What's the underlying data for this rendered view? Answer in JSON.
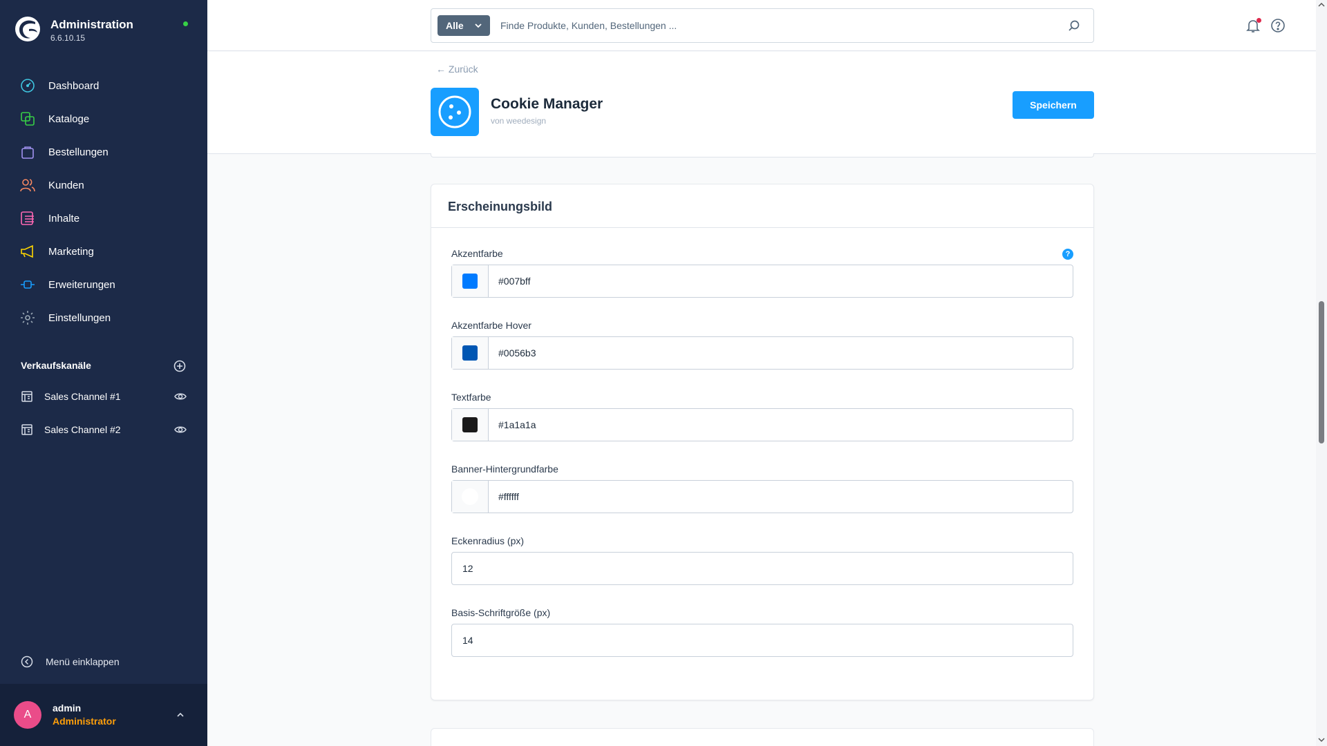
{
  "brand": {
    "title": "Administration",
    "version": "6.6.10.15",
    "status_color": "#37d046"
  },
  "nav": [
    {
      "label": "Dashboard",
      "icon": "dashboard-icon",
      "color": "#3fc6e0"
    },
    {
      "label": "Kataloge",
      "icon": "catalog-icon",
      "color": "#37d046"
    },
    {
      "label": "Bestellungen",
      "icon": "bag-icon",
      "color": "#a092f0"
    },
    {
      "label": "Kunden",
      "icon": "users-icon",
      "color": "#f88962"
    },
    {
      "label": "Inhalte",
      "icon": "content-icon",
      "color": "#ff68b4"
    },
    {
      "label": "Marketing",
      "icon": "megaphone-icon",
      "color": "#ffd700"
    },
    {
      "label": "Erweiterungen",
      "icon": "plugin-icon",
      "color": "#189eff"
    },
    {
      "label": "Einstellungen",
      "icon": "gear-icon",
      "color": "#9aa8b5"
    }
  ],
  "sales_channels": {
    "title": "Verkaufskanäle",
    "items": [
      {
        "label": "Sales Channel #1"
      },
      {
        "label": "Sales Channel #2"
      }
    ]
  },
  "collapse_label": "Menü einklappen",
  "user": {
    "initial": "A",
    "name": "admin",
    "role": "Administrator"
  },
  "search": {
    "type_label": "Alle",
    "placeholder": "Finde Produkte, Kunden, Bestellungen ..."
  },
  "header": {
    "back_label": "Zurück",
    "title": "Cookie Manager",
    "vendor": "von weedesign",
    "save_label": "Speichern"
  },
  "card": {
    "title": "Erscheinungsbild",
    "fields": [
      {
        "label": "Akzentfarbe",
        "value": "#007bff",
        "swatch": "#007bff",
        "type": "color"
      },
      {
        "label": "Akzentfarbe Hover",
        "value": "#0056b3",
        "swatch": "#0056b3",
        "type": "color"
      },
      {
        "label": "Textfarbe",
        "value": "#1a1a1a",
        "swatch": "#1a1a1a",
        "type": "color"
      },
      {
        "label": "Banner-Hintergrundfarbe",
        "value": "#ffffff",
        "swatch": "#ffffff",
        "type": "color"
      },
      {
        "label": "Eckenradius (px)",
        "value": "12",
        "type": "number"
      },
      {
        "label": "Basis-Schriftgröße (px)",
        "value": "14",
        "type": "number"
      }
    ],
    "help_glyph": "?"
  },
  "colors": {
    "accent": "#189eff",
    "sidebar": "#1c2a48"
  }
}
